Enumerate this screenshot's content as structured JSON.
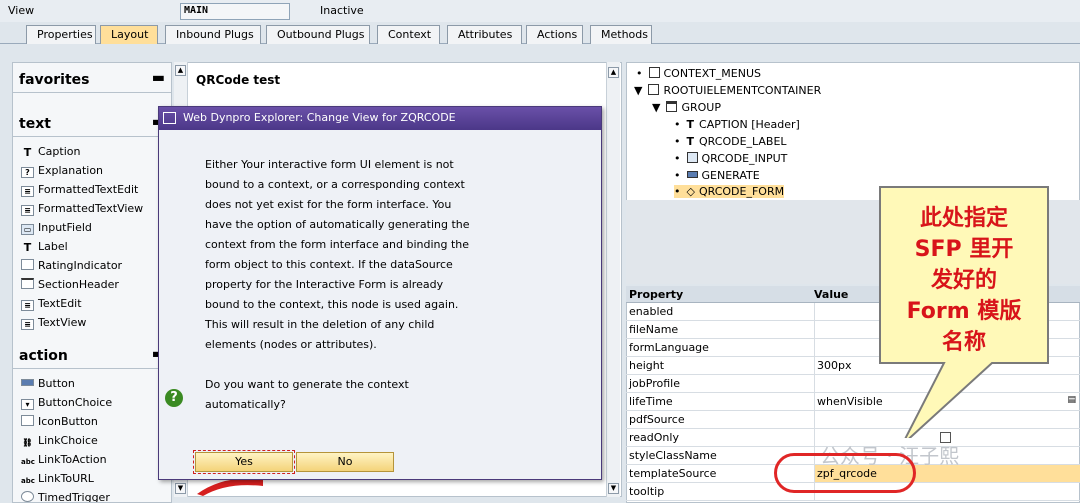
{
  "header": {
    "view_label": "View",
    "view_name": "MAIN",
    "status": "Inactive"
  },
  "tabs": [
    "Properties",
    "Layout",
    "Inbound Plugs",
    "Outbound Plugs",
    "Context",
    "Attributes",
    "Actions",
    "Methods"
  ],
  "palette": {
    "favorites": "favorites",
    "text_cat": "text",
    "text_items": [
      "Caption",
      "Explanation",
      "FormattedTextEdit",
      "FormattedTextView",
      "InputField",
      "Label",
      "RatingIndicator",
      "SectionHeader",
      "TextEdit",
      "TextView"
    ],
    "action_cat": "action",
    "action_items": [
      "Button",
      "ButtonChoice",
      "IconButton",
      "LinkChoice",
      "LinkToAction",
      "LinkToURL",
      "TimedTrigger"
    ]
  },
  "layout": {
    "title": "QRCode test"
  },
  "dialog": {
    "title": "Web Dynpro Explorer: Change View for ZQRCODE",
    "message": "Either Your interactive form UI element is not\nbound to a context, or a corresponding context\ndoes not yet exist for the form interface. You\nhave the option of automatically generating the\ncontext from the form interface and binding the\nform object to this context. If the dataSource\nproperty for the Interactive Form is already\nbound to the context, this node is used again.\nThis will result in the deletion of any child\nelements (nodes or attributes).",
    "question": "Do you want to generate the context\nautomatically?",
    "yes": "Yes",
    "no": "No"
  },
  "tree": [
    "CONTEXT_MENUS",
    "ROOTUIELEMENTCONTAINER",
    "GROUP",
    "CAPTION  [Header]",
    "QRCODE_LABEL",
    "QRCODE_INPUT",
    "GENERATE",
    "QRCODE_FORM"
  ],
  "properties": {
    "col_property": "Property",
    "col_value": "Value",
    "rows": [
      {
        "name": "enabled",
        "value": ""
      },
      {
        "name": "fileName",
        "value": ""
      },
      {
        "name": "formLanguage",
        "value": ""
      },
      {
        "name": "height",
        "value": "300px"
      },
      {
        "name": "jobProfile",
        "value": ""
      },
      {
        "name": "lifeTime",
        "value": "whenVisible"
      },
      {
        "name": "pdfSource",
        "value": ""
      },
      {
        "name": "readOnly",
        "value": ""
      },
      {
        "name": "styleClassName",
        "value": ""
      },
      {
        "name": "templateSource",
        "value": "zpf_qrcode"
      },
      {
        "name": "tooltip",
        "value": ""
      }
    ]
  },
  "callout": "此处指定\nSFP 里开\n发好的\nForm 模版\n名称",
  "watermark": "公众号 · 汪子熙",
  "colors": {
    "accent": "#ffdf9a",
    "dialog_title": "#4b3788",
    "callout_text": "#d8141a",
    "callout_fill": "#fff9b8"
  }
}
